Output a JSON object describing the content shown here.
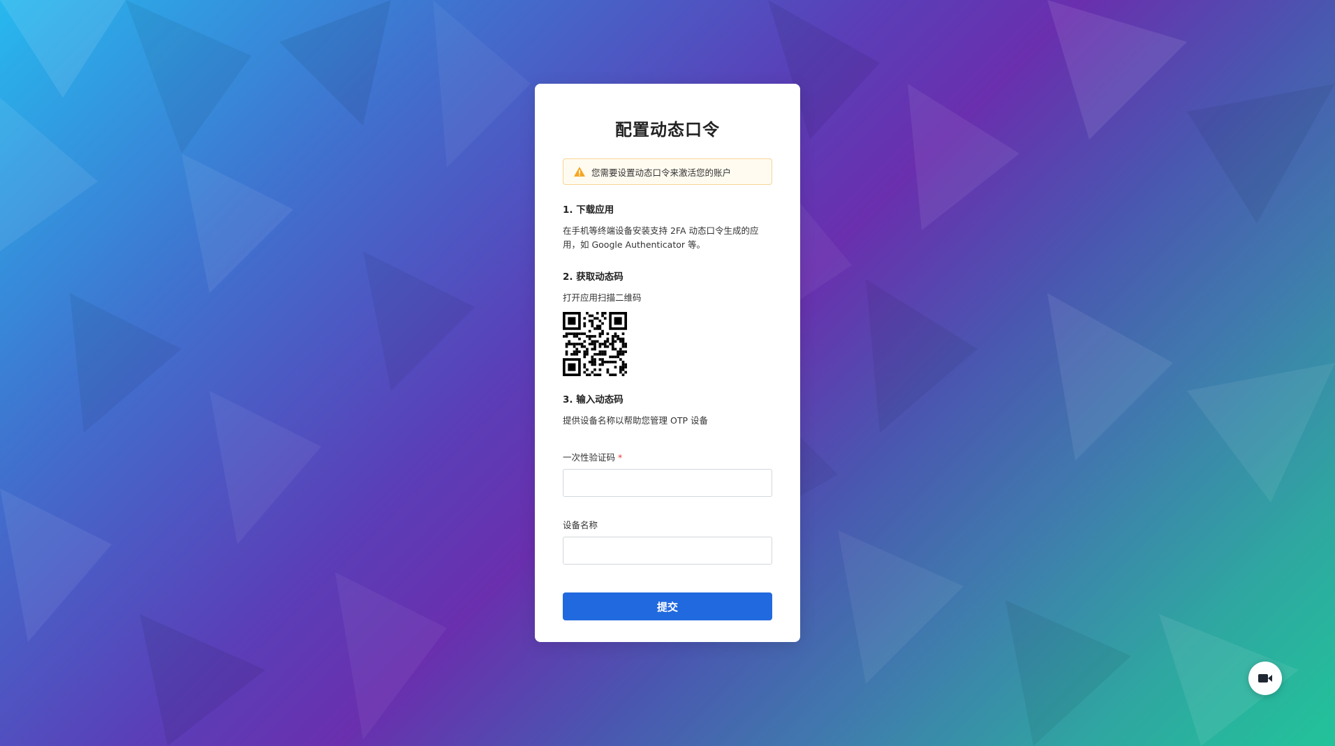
{
  "page": {
    "title": "配置动态口令"
  },
  "alert": {
    "text": "您需要设置动态口令来激活您的账户",
    "icon": "warning-icon",
    "color": "#f5a623"
  },
  "steps": [
    {
      "heading": "1. 下载应用",
      "text": "在手机等终端设备安装支持 2FA 动态口令生成的应用，如 Google Authenticator 等。"
    },
    {
      "heading": "2. 获取动态码",
      "text": "打开应用扫描二维码"
    },
    {
      "heading": "3. 输入动态码",
      "text": "提供设备名称以帮助您管理 OTP 设备"
    }
  ],
  "form": {
    "otp_label": "一次性验证码",
    "otp_required_mark": "*",
    "otp_value": "",
    "device_label": "设备名称",
    "device_value": "",
    "submit_label": "提交"
  },
  "floating": {
    "icon": "video-camera-icon"
  },
  "colors": {
    "primary": "#2169de",
    "required": "#e33333",
    "warning": "#f5a623"
  }
}
